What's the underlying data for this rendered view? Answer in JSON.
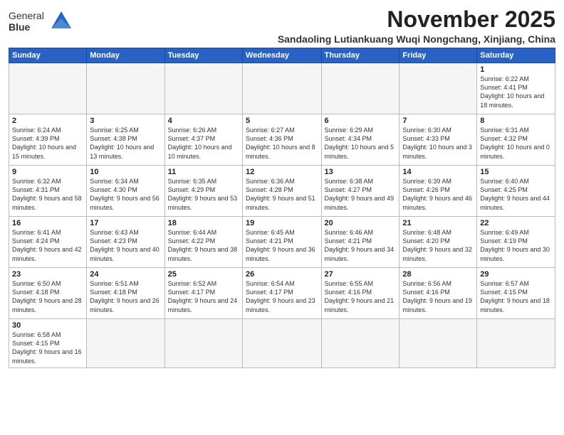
{
  "header": {
    "logo_line1": "General",
    "logo_line2": "Blue",
    "month": "November 2025",
    "location": "Sandaoling Lutiankuang Wuqi Nongchang, Xinjiang, China"
  },
  "weekdays": [
    "Sunday",
    "Monday",
    "Tuesday",
    "Wednesday",
    "Thursday",
    "Friday",
    "Saturday"
  ],
  "weeks": [
    [
      {
        "day": "",
        "info": ""
      },
      {
        "day": "",
        "info": ""
      },
      {
        "day": "",
        "info": ""
      },
      {
        "day": "",
        "info": ""
      },
      {
        "day": "",
        "info": ""
      },
      {
        "day": "",
        "info": ""
      },
      {
        "day": "1",
        "info": "Sunrise: 6:22 AM\nSunset: 4:41 PM\nDaylight: 10 hours\nand 18 minutes."
      }
    ],
    [
      {
        "day": "2",
        "info": "Sunrise: 6:24 AM\nSunset: 4:39 PM\nDaylight: 10 hours\nand 15 minutes."
      },
      {
        "day": "3",
        "info": "Sunrise: 6:25 AM\nSunset: 4:38 PM\nDaylight: 10 hours\nand 13 minutes."
      },
      {
        "day": "4",
        "info": "Sunrise: 6:26 AM\nSunset: 4:37 PM\nDaylight: 10 hours\nand 10 minutes."
      },
      {
        "day": "5",
        "info": "Sunrise: 6:27 AM\nSunset: 4:36 PM\nDaylight: 10 hours\nand 8 minutes."
      },
      {
        "day": "6",
        "info": "Sunrise: 6:29 AM\nSunset: 4:34 PM\nDaylight: 10 hours\nand 5 minutes."
      },
      {
        "day": "7",
        "info": "Sunrise: 6:30 AM\nSunset: 4:33 PM\nDaylight: 10 hours\nand 3 minutes."
      },
      {
        "day": "8",
        "info": "Sunrise: 6:31 AM\nSunset: 4:32 PM\nDaylight: 10 hours\nand 0 minutes."
      }
    ],
    [
      {
        "day": "9",
        "info": "Sunrise: 6:32 AM\nSunset: 4:31 PM\nDaylight: 9 hours\nand 58 minutes."
      },
      {
        "day": "10",
        "info": "Sunrise: 6:34 AM\nSunset: 4:30 PM\nDaylight: 9 hours\nand 56 minutes."
      },
      {
        "day": "11",
        "info": "Sunrise: 6:35 AM\nSunset: 4:29 PM\nDaylight: 9 hours\nand 53 minutes."
      },
      {
        "day": "12",
        "info": "Sunrise: 6:36 AM\nSunset: 4:28 PM\nDaylight: 9 hours\nand 51 minutes."
      },
      {
        "day": "13",
        "info": "Sunrise: 6:38 AM\nSunset: 4:27 PM\nDaylight: 9 hours\nand 49 minutes."
      },
      {
        "day": "14",
        "info": "Sunrise: 6:39 AM\nSunset: 4:26 PM\nDaylight: 9 hours\nand 46 minutes."
      },
      {
        "day": "15",
        "info": "Sunrise: 6:40 AM\nSunset: 4:25 PM\nDaylight: 9 hours\nand 44 minutes."
      }
    ],
    [
      {
        "day": "16",
        "info": "Sunrise: 6:41 AM\nSunset: 4:24 PM\nDaylight: 9 hours\nand 42 minutes."
      },
      {
        "day": "17",
        "info": "Sunrise: 6:43 AM\nSunset: 4:23 PM\nDaylight: 9 hours\nand 40 minutes."
      },
      {
        "day": "18",
        "info": "Sunrise: 6:44 AM\nSunset: 4:22 PM\nDaylight: 9 hours\nand 38 minutes."
      },
      {
        "day": "19",
        "info": "Sunrise: 6:45 AM\nSunset: 4:21 PM\nDaylight: 9 hours\nand 36 minutes."
      },
      {
        "day": "20",
        "info": "Sunrise: 6:46 AM\nSunset: 4:21 PM\nDaylight: 9 hours\nand 34 minutes."
      },
      {
        "day": "21",
        "info": "Sunrise: 6:48 AM\nSunset: 4:20 PM\nDaylight: 9 hours\nand 32 minutes."
      },
      {
        "day": "22",
        "info": "Sunrise: 6:49 AM\nSunset: 4:19 PM\nDaylight: 9 hours\nand 30 minutes."
      }
    ],
    [
      {
        "day": "23",
        "info": "Sunrise: 6:50 AM\nSunset: 4:18 PM\nDaylight: 9 hours\nand 28 minutes."
      },
      {
        "day": "24",
        "info": "Sunrise: 6:51 AM\nSunset: 4:18 PM\nDaylight: 9 hours\nand 26 minutes."
      },
      {
        "day": "25",
        "info": "Sunrise: 6:52 AM\nSunset: 4:17 PM\nDaylight: 9 hours\nand 24 minutes."
      },
      {
        "day": "26",
        "info": "Sunrise: 6:54 AM\nSunset: 4:17 PM\nDaylight: 9 hours\nand 23 minutes."
      },
      {
        "day": "27",
        "info": "Sunrise: 6:55 AM\nSunset: 4:16 PM\nDaylight: 9 hours\nand 21 minutes."
      },
      {
        "day": "28",
        "info": "Sunrise: 6:56 AM\nSunset: 4:16 PM\nDaylight: 9 hours\nand 19 minutes."
      },
      {
        "day": "29",
        "info": "Sunrise: 6:57 AM\nSunset: 4:15 PM\nDaylight: 9 hours\nand 18 minutes."
      }
    ],
    [
      {
        "day": "30",
        "info": "Sunrise: 6:58 AM\nSunset: 4:15 PM\nDaylight: 9 hours\nand 16 minutes."
      },
      {
        "day": "",
        "info": ""
      },
      {
        "day": "",
        "info": ""
      },
      {
        "day": "",
        "info": ""
      },
      {
        "day": "",
        "info": ""
      },
      {
        "day": "",
        "info": ""
      },
      {
        "day": "",
        "info": ""
      }
    ]
  ]
}
